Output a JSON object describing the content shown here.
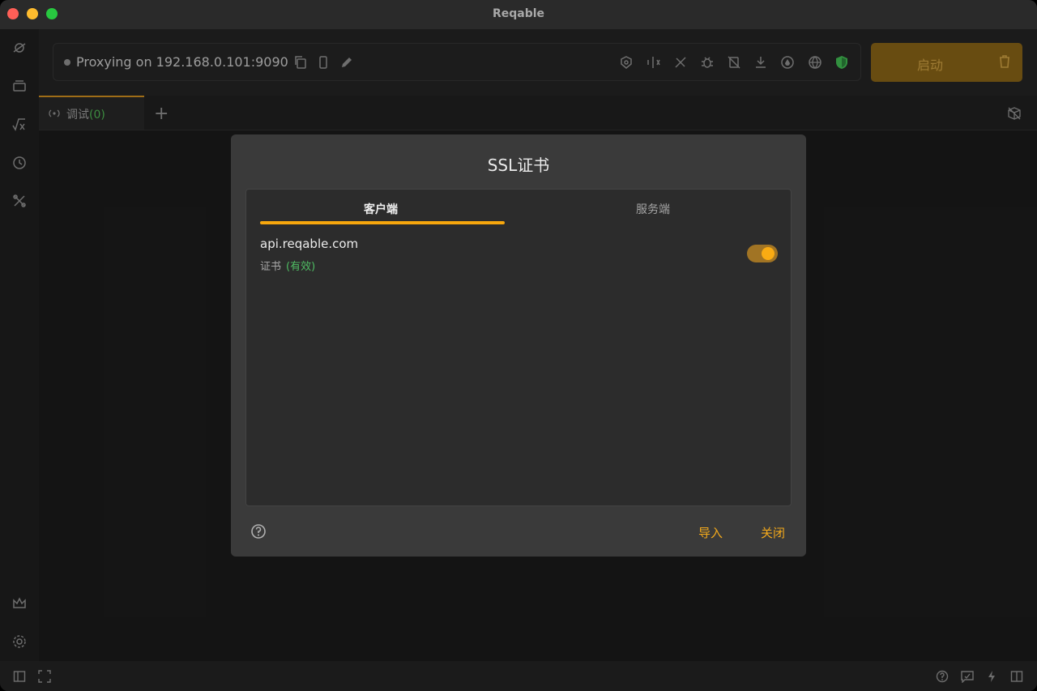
{
  "window": {
    "title": "Reqable"
  },
  "toolbar": {
    "proxy_status": "Proxying on 192.168.0.101:9090",
    "start_label": "启动",
    "colors": {
      "start_bg": "#835f16",
      "start_text": "#c69a40",
      "shield": "#3fb54f"
    }
  },
  "tabs": {
    "debug_label": "调试",
    "debug_count": "(0)"
  },
  "dialog": {
    "title": "SSL证书",
    "tabs": {
      "client": "客户端",
      "server": "服务端"
    },
    "entry": {
      "domain": "api.reqable.com",
      "cert_label": "证书",
      "cert_status": "(有效)",
      "enabled": true
    },
    "buttons": {
      "import": "导入",
      "close": "关闭"
    },
    "colors": {
      "accent": "#f3a91c",
      "valid": "#4fbd63"
    }
  }
}
